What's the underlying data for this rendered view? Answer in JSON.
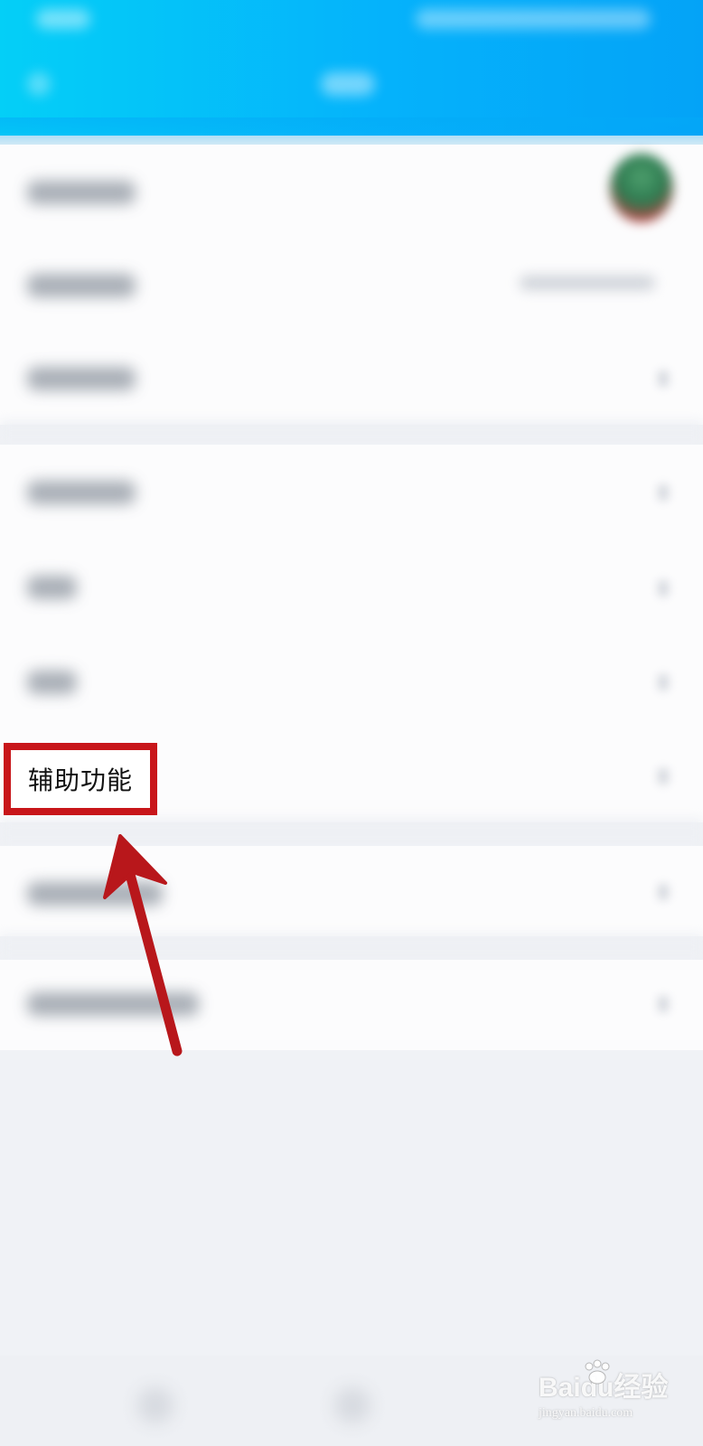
{
  "highlight": {
    "label": "辅助功能"
  },
  "watermark": {
    "brand_left": "Bai",
    "brand_mid": "du",
    "brand_right": "经验",
    "url": "jingyan.baidu.com"
  },
  "colors": {
    "header_start": "#04cff7",
    "header_end": "#04a3f7",
    "highlight_red": "#c8161a",
    "arrow_red": "#b8171b"
  },
  "icons": {
    "avatar": "avatar-image",
    "row_chevron": "chevron-right-icon",
    "annotation": "red-arrow"
  }
}
